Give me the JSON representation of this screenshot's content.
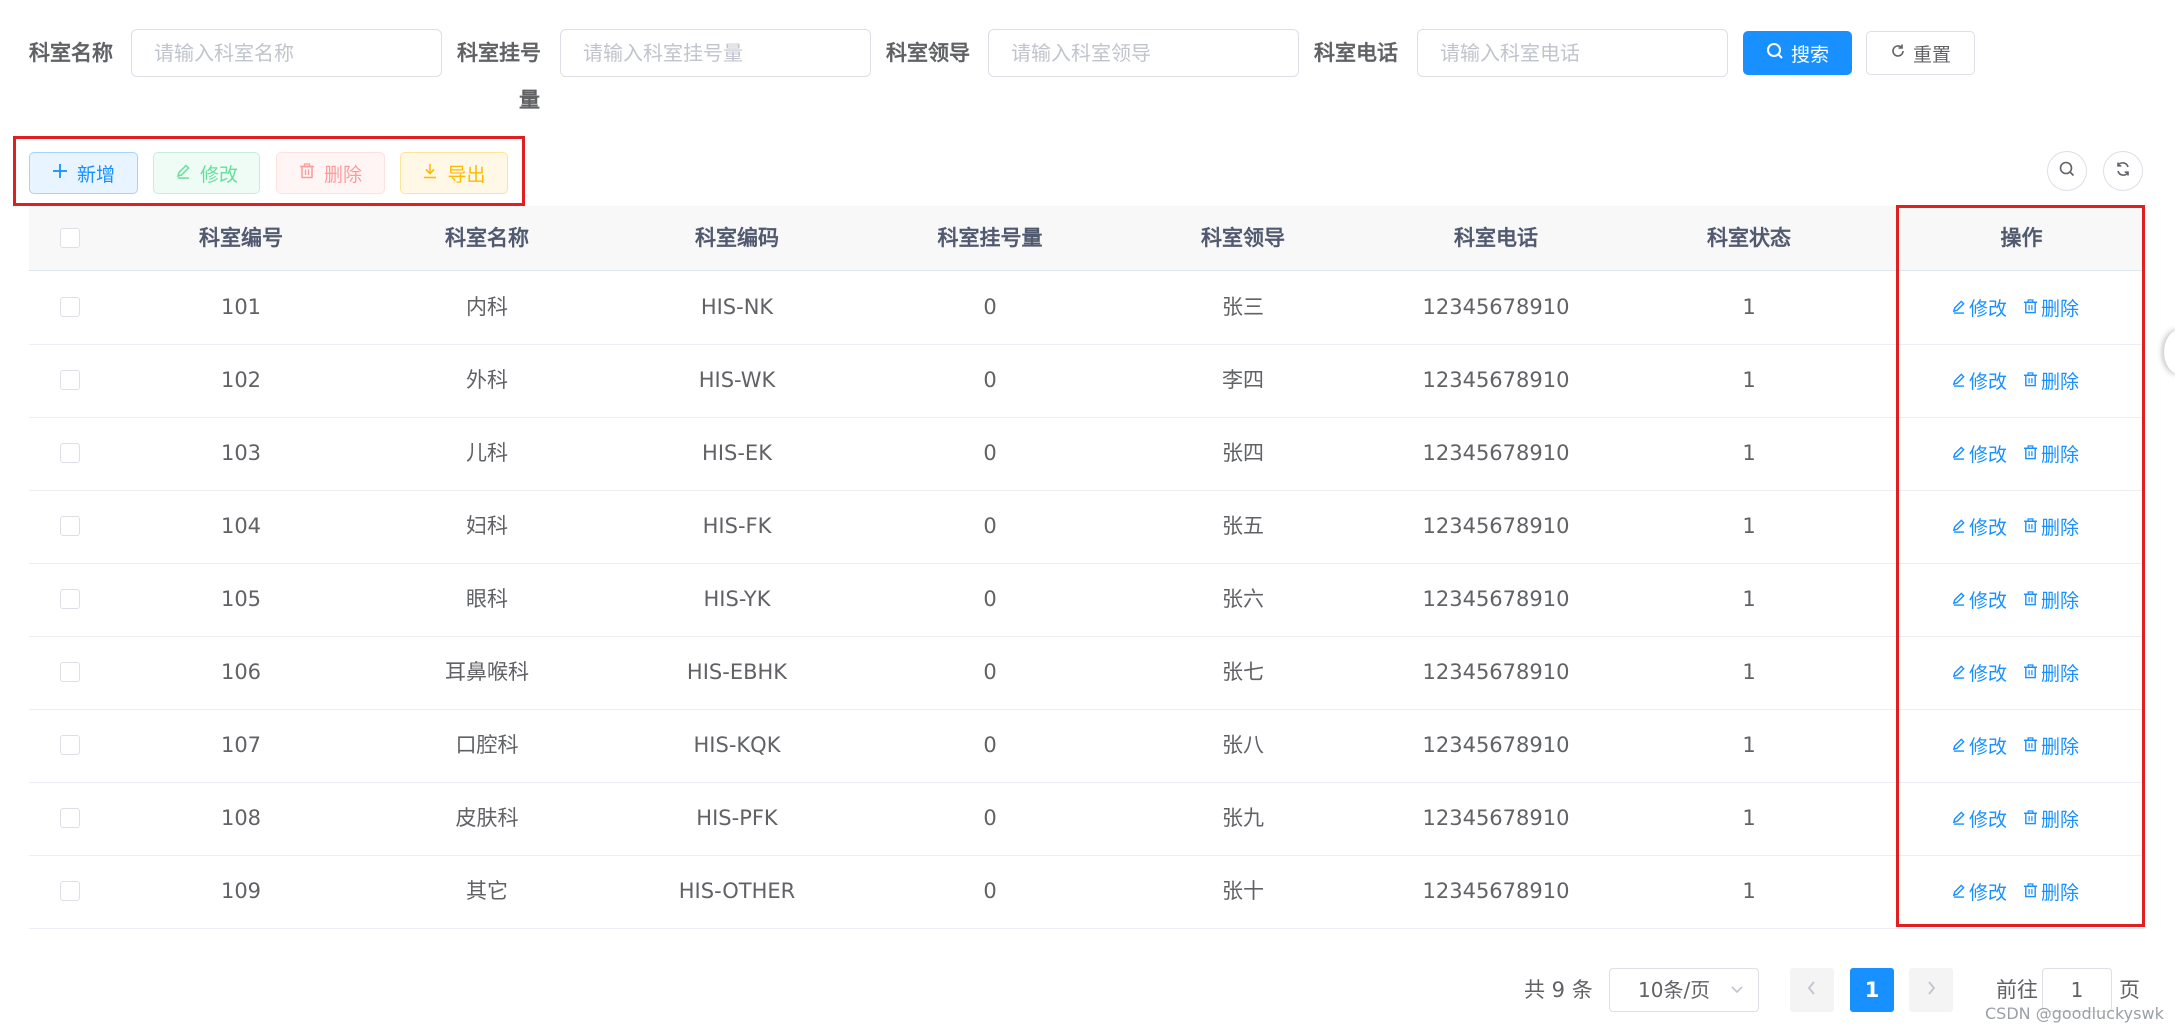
{
  "search": {
    "fields": [
      {
        "label": "科室名称",
        "placeholder": "请输入科室名称"
      },
      {
        "label": "科室挂号",
        "label_wrap": "量",
        "placeholder": "请输入科室挂号量"
      },
      {
        "label": "科室领导",
        "placeholder": "请输入科室领导"
      },
      {
        "label": "科室电话",
        "placeholder": "请输入科室电话"
      }
    ],
    "search_label": "搜索",
    "reset_label": "重置"
  },
  "toolbar": {
    "add_label": "新增",
    "edit_label": "修改",
    "delete_label": "删除",
    "export_label": "导出"
  },
  "table": {
    "columns": [
      "科室编号",
      "科室名称",
      "科室编码",
      "科室挂号量",
      "科室领导",
      "科室电话",
      "科室状态",
      "操作"
    ],
    "rows": [
      {
        "id": "101",
        "name": "内科",
        "code": "HIS-NK",
        "count": "0",
        "leader": "张三",
        "phone": "12345678910",
        "status": "1"
      },
      {
        "id": "102",
        "name": "外科",
        "code": "HIS-WK",
        "count": "0",
        "leader": "李四",
        "phone": "12345678910",
        "status": "1"
      },
      {
        "id": "103",
        "name": "儿科",
        "code": "HIS-EK",
        "count": "0",
        "leader": "张四",
        "phone": "12345678910",
        "status": "1"
      },
      {
        "id": "104",
        "name": "妇科",
        "code": "HIS-FK",
        "count": "0",
        "leader": "张五",
        "phone": "12345678910",
        "status": "1"
      },
      {
        "id": "105",
        "name": "眼科",
        "code": "HIS-YK",
        "count": "0",
        "leader": "张六",
        "phone": "12345678910",
        "status": "1"
      },
      {
        "id": "106",
        "name": "耳鼻喉科",
        "code": "HIS-EBHK",
        "count": "0",
        "leader": "张七",
        "phone": "12345678910",
        "status": "1"
      },
      {
        "id": "107",
        "name": "口腔科",
        "code": "HIS-KQK",
        "count": "0",
        "leader": "张八",
        "phone": "12345678910",
        "status": "1"
      },
      {
        "id": "108",
        "name": "皮肤科",
        "code": "HIS-PFK",
        "count": "0",
        "leader": "张九",
        "phone": "12345678910",
        "status": "1"
      },
      {
        "id": "109",
        "name": "其它",
        "code": "HIS-OTHER",
        "count": "0",
        "leader": "张十",
        "phone": "12345678910",
        "status": "1"
      }
    ],
    "row_edit_label": "修改",
    "row_delete_label": "删除"
  },
  "pagination": {
    "total_text": "共 9 条",
    "page_size": "10条/页",
    "current_page": "1",
    "goto_prefix": "前往",
    "goto_value": "1",
    "goto_suffix": "页"
  },
  "watermark": "CSDN @goodluckyswk",
  "colors": {
    "primary": "#1890ff",
    "success": "#13ce66",
    "danger": "#ff4949",
    "warning": "#ffba00",
    "highlight_box": "#e02020"
  }
}
